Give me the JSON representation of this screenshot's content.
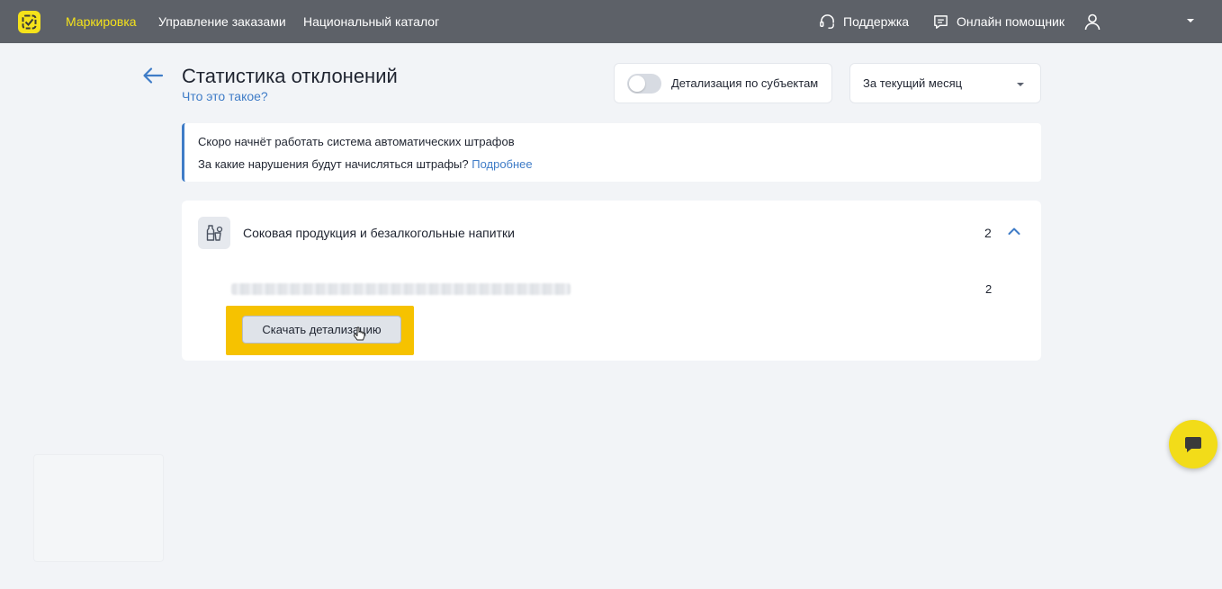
{
  "colors": {
    "topbar": "#5d6168",
    "brand_yellow": "#f5e21b",
    "link_blue": "#3f7cc7",
    "highlight": "#f6c200",
    "background": "#f2f4f7"
  },
  "topbar": {
    "logo_icon": "brand-logo-icon",
    "nav": [
      {
        "label": "Маркировка",
        "active": true
      },
      {
        "label": "Управление заказами",
        "active": false
      },
      {
        "label": "Национальный каталог",
        "active": false
      }
    ],
    "support_label": "Поддержка",
    "support_icon": "headset-icon",
    "assistant_label": "Онлайн помощник",
    "assistant_icon": "chat-bubble-icon",
    "user_icon": "user-icon"
  },
  "header": {
    "title": "Статистика отклонений",
    "help_link": "Что это такое?",
    "toggle_label": "Детализация по субъектам",
    "toggle_on": false,
    "period_value": "За текущий месяц"
  },
  "notice": {
    "title": "Скоро начнёт работать система автоматических штрафов",
    "text": "За какие нарушения будут начисляться штрафы?",
    "link": "Подробнее"
  },
  "category": {
    "icon": "beverage-bottle-icon",
    "title": "Соковая продукция и безалкогольные напитки",
    "count": "2",
    "expanded": true,
    "rows": [
      {
        "count": "2"
      }
    ],
    "download_label": "Скачать детализацию"
  },
  "chat_fab_icon": "chat-icon"
}
